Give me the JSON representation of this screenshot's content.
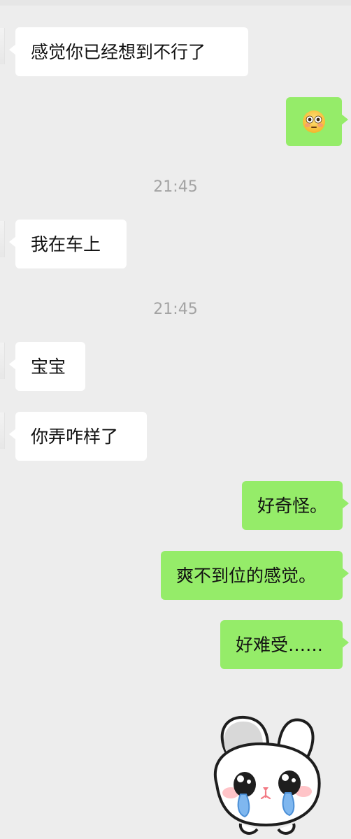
{
  "messages": [
    {
      "side": "incoming",
      "type": "text",
      "text": "感觉你已经想到不行了"
    },
    {
      "side": "outgoing",
      "type": "emoji",
      "icon": "flushed-face-icon"
    },
    {
      "type": "timestamp",
      "text": "21:45"
    },
    {
      "side": "incoming",
      "type": "text",
      "text": "我在车上"
    },
    {
      "type": "timestamp",
      "text": "21:45"
    },
    {
      "side": "incoming",
      "type": "text",
      "text": "宝宝"
    },
    {
      "side": "incoming",
      "type": "text",
      "text": "你弄咋样了"
    },
    {
      "side": "outgoing",
      "type": "text",
      "text": "好奇怪。"
    },
    {
      "side": "outgoing",
      "type": "text",
      "text": "爽不到位的感觉。"
    },
    {
      "side": "outgoing",
      "type": "text",
      "text": "好难受……"
    },
    {
      "side": "outgoing",
      "type": "sticker",
      "icon": "crying-bunny-sticker"
    }
  ],
  "colors": {
    "background": "#ededed",
    "incoming_bubble": "#ffffff",
    "outgoing_bubble": "#95ec69",
    "timestamp_text": "#a3a3a3"
  }
}
